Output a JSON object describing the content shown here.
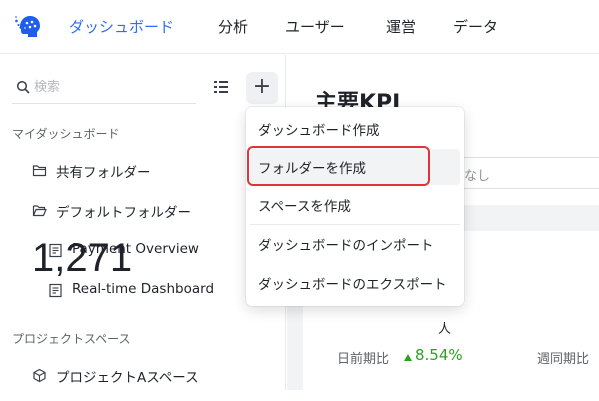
{
  "nav": {
    "items": [
      {
        "label": "ダッシュボード",
        "active": true
      },
      {
        "label": "分析"
      },
      {
        "label": "ユーザー"
      },
      {
        "label": "運営"
      },
      {
        "label": "データ"
      }
    ]
  },
  "sidebar": {
    "search_placeholder": "検索",
    "add_label": "+",
    "my_dashboards_title": "マイダッシュボード",
    "items": [
      {
        "label": "共有フォルダー",
        "icon": "folder-icon"
      },
      {
        "label": "デフォルトフォルダー",
        "icon": "folder-open-icon"
      },
      {
        "label": "Payment Overview",
        "icon": "dashboard-doc-icon"
      },
      {
        "label": "Real-time Dashboard",
        "icon": "dashboard-doc-icon"
      }
    ],
    "project_spaces_title": "プロジェクトスペース",
    "project_items": [
      {
        "label": "プロジェクトAスペース",
        "icon": "cube-icon"
      }
    ]
  },
  "main": {
    "title": "主要KPI",
    "filter_value": "なし",
    "kpi": {
      "value": "1,271",
      "unit": "人",
      "compare_label": "日前期比",
      "compare_value": "8.54%",
      "compare_label_2": "週同期比"
    }
  },
  "menu": {
    "items": [
      {
        "label": "ダッシュボード作成"
      },
      {
        "label": "フォルダーを作成",
        "highlighted": true
      },
      {
        "label": "スペースを作成"
      },
      {
        "label": "ダッシュボードのインポート"
      },
      {
        "label": "ダッシュボードのエクスポート"
      }
    ]
  },
  "colors": {
    "accent": "#2f6df6",
    "positive": "#2ea121",
    "highlight_border": "#e0343a"
  }
}
